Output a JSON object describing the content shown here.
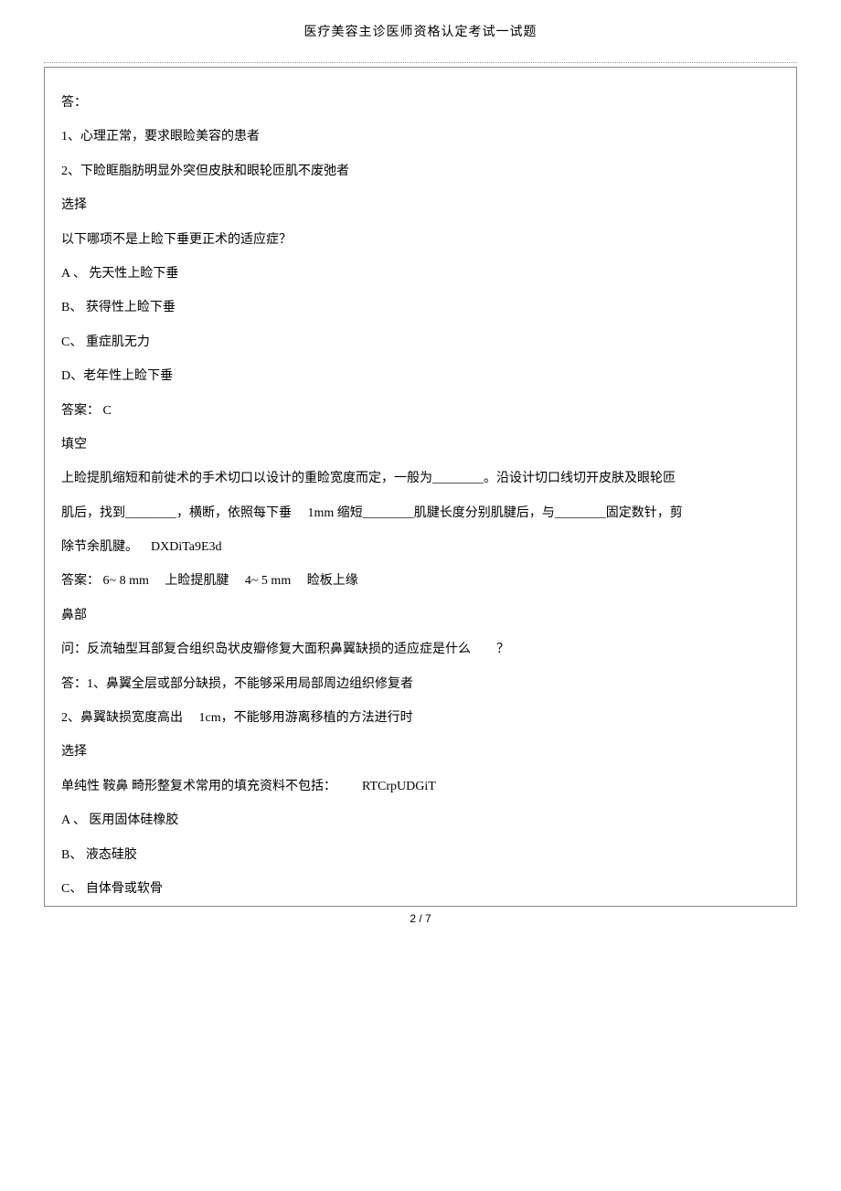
{
  "header": "医疗美容主诊医师资格认定考试一试题",
  "lines": {
    "ans_label": "答：",
    "a1": "1、心理正常，要求眼睑美容的患者",
    "a2": "2、下睑眶脂肪明显外突但皮肤和眼轮匝肌不废弛者",
    "choose_label": "选择",
    "q1": "以下哪项不是上睑下垂更正术的适应症？",
    "q1_optA": "A 、  先天性上睑下垂",
    "q1_optB": "B、  获得性上睑下垂",
    "q1_optC": "C、  重症肌无力",
    "q1_optD": "D、老年性上睑下垂",
    "q1_ans": "答案： C",
    "fill_label": "填空",
    "fill_text_1": "上睑提肌缩短和前徙术的手术切口以设计的重睑宽度而定，一般为________。沿设计切口线切开皮肤及眼轮匝",
    "fill_text_2": "肌后，找到________，横断，依照每下垂  1mm 缩短________肌腱长度分别肌腱后，与________固定数针，剪",
    "fill_text_3": "除节余肌腱。 DXDiTa9E3d",
    "fill_ans": "  答案： 6~ 8 mm  上睑提肌腱  4~ 5 mm  睑板上缘",
    "nose_label": "鼻部",
    "nose_q": "问：反流轴型耳部复合组织岛状皮瓣修复大面积鼻翼缺损的适应症是什么  ？",
    "nose_a1": "答：1、鼻翼全层或部分缺损，不能够采用局部周边组织修复者",
    "nose_a2": "2、鼻翼缺损宽度高出  1cm，不能够用游离移植的方法进行时",
    "choose_label2": "选择",
    "q2": "单纯性 鞍鼻 畸形整复术常用的填充资料不包括：  RTCrpUDGiT",
    "q2_optA": "A 、  医用固体硅橡胶",
    "q2_optB": "B、  液态硅胶",
    "q2_optC": "C、  自体骨或软骨"
  },
  "footer": "2 / 7"
}
